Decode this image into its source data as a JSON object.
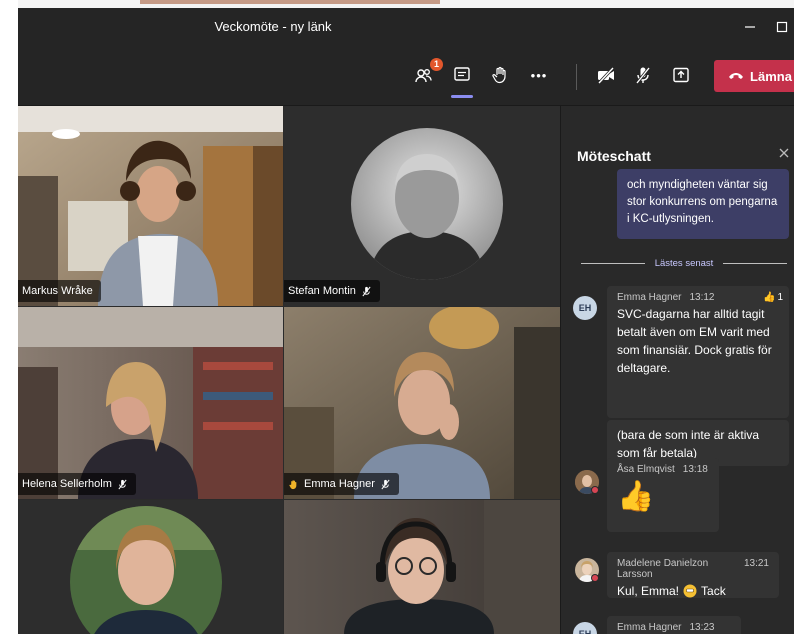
{
  "window": {
    "title": "Veckomöte - ny länk"
  },
  "toolbar": {
    "participants_badge": "1",
    "leave_label": "Lämna",
    "more_label": "•••"
  },
  "tiles": [
    {
      "name": "Markus Wråke",
      "muted": false,
      "hand_raised": false
    },
    {
      "name": "Stefan Montin",
      "muted": true,
      "hand_raised": false
    },
    {
      "name": "Helena Sellerholm",
      "muted": true,
      "hand_raised": false
    },
    {
      "name": "Emma Hagner",
      "muted": true,
      "hand_raised": true
    },
    {
      "name": "",
      "muted": false,
      "hand_raised": false
    },
    {
      "name": "",
      "muted": false,
      "hand_raised": false
    }
  ],
  "chat": {
    "title": "Möteschatt",
    "self_message": "och myndigheten väntar sig stor konkurrens om pengarna i KC-utlysningen.",
    "last_read": "Lästes senast",
    "messages": [
      {
        "author": "Emma Hagner",
        "initials": "EH",
        "time": "13:12",
        "text": "SVC-dagarna har alltid tagit betalt även om EM varit med som finansiär. Dock gratis för deltagare.",
        "reaction_count": "1"
      },
      {
        "text": "(bara de som inte är aktiva som får betala)"
      },
      {
        "author": "Åsa Elmqvist",
        "time": "13:18",
        "emoji": "👍"
      },
      {
        "author": "Madelene Danielzon Larsson",
        "time": "13:21",
        "text_before": "Kul, Emma!",
        "text_after": "Tack"
      },
      {
        "author": "Emma Hagner",
        "initials": "EH",
        "time": "13:23"
      }
    ]
  },
  "colors": {
    "leave": "#c4314b",
    "accent": "#8b8df0",
    "self_bubble": "#3d3e66",
    "badge": "#e2572c"
  }
}
